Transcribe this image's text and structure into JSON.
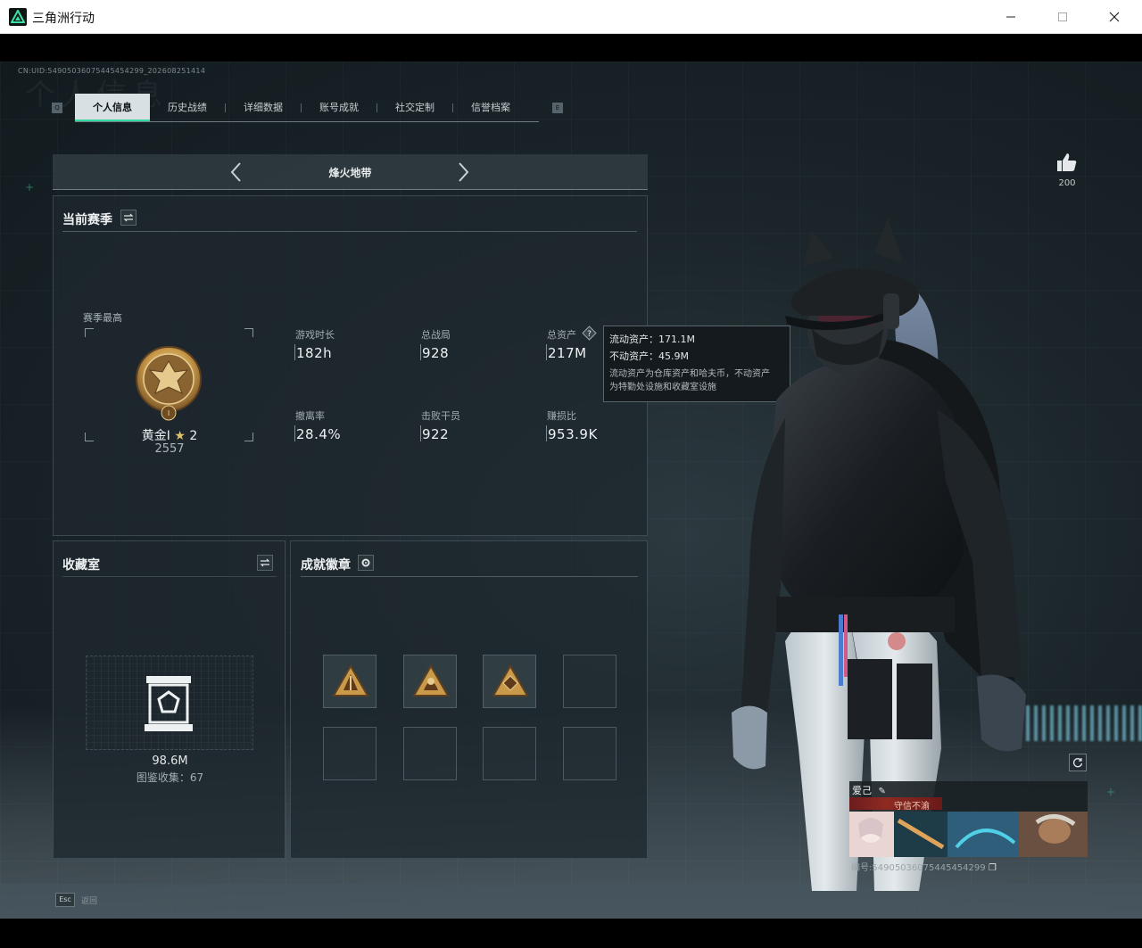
{
  "window": {
    "title": "三角洲行动",
    "minimize": "—",
    "maximize": "☐",
    "close": "✕"
  },
  "header": {
    "uid": "CN:UID:5490503607544545​4299_202608251414",
    "bg_title": "个人信息"
  },
  "tabs": {
    "left_key": "Q",
    "right_key": "E",
    "items": [
      {
        "label": "个人信息",
        "active": true
      },
      {
        "label": "历史战绩",
        "active": false
      },
      {
        "label": "详细数据",
        "active": false
      },
      {
        "label": "账号成就",
        "active": false
      },
      {
        "label": "社交定制",
        "active": false
      },
      {
        "label": "信誉档案",
        "active": false
      }
    ]
  },
  "mode": {
    "title": "烽火地带"
  },
  "season": {
    "title": "当前赛季",
    "best_label": "赛季最高",
    "rank_name": "黄金I",
    "rank_stars": "2",
    "rank_score": "2557",
    "stats": [
      {
        "label": "游戏时长",
        "value": "182h"
      },
      {
        "label": "总战局",
        "value": "928"
      },
      {
        "label": "总资产",
        "value": "217M"
      },
      {
        "label": "撤离率",
        "value": "28.4%"
      },
      {
        "label": "击败干员",
        "value": "922"
      },
      {
        "label": "赚损比",
        "value": "953.9K"
      }
    ]
  },
  "tooltip": {
    "liquid": "流动资产：171.1M",
    "fixed": "不动资产：45.9M",
    "desc1": "流动资产为仓库资产和哈夫币，不动资产",
    "desc2": "为特勤处设施和收藏室设施"
  },
  "collection": {
    "title": "收藏室",
    "value": "98.6M",
    "count_text": "图鉴收集：67"
  },
  "achievements": {
    "title": "成就徽章",
    "filled_slots": 3,
    "total_slots": 8
  },
  "like": {
    "count": "200"
  },
  "player_card": {
    "name": "爱己",
    "title": "守信不渝",
    "id_text": "编号:5490503607544545​4299"
  },
  "footer": {
    "esc_key": "Esc",
    "esc_label": "返回"
  },
  "colors": {
    "accent": "#2fd9a0",
    "gold": "#c89a4a",
    "title_red": "#8e2a22"
  },
  "icons": [
    "app-logo-icon",
    "arrow-left-icon",
    "arrow-right-icon",
    "swap-icon",
    "help-icon",
    "settings-icon",
    "thumbs-up-icon",
    "refresh-icon",
    "edit-icon",
    "copy-icon",
    "vault-icon",
    "rank-badge-icon"
  ]
}
